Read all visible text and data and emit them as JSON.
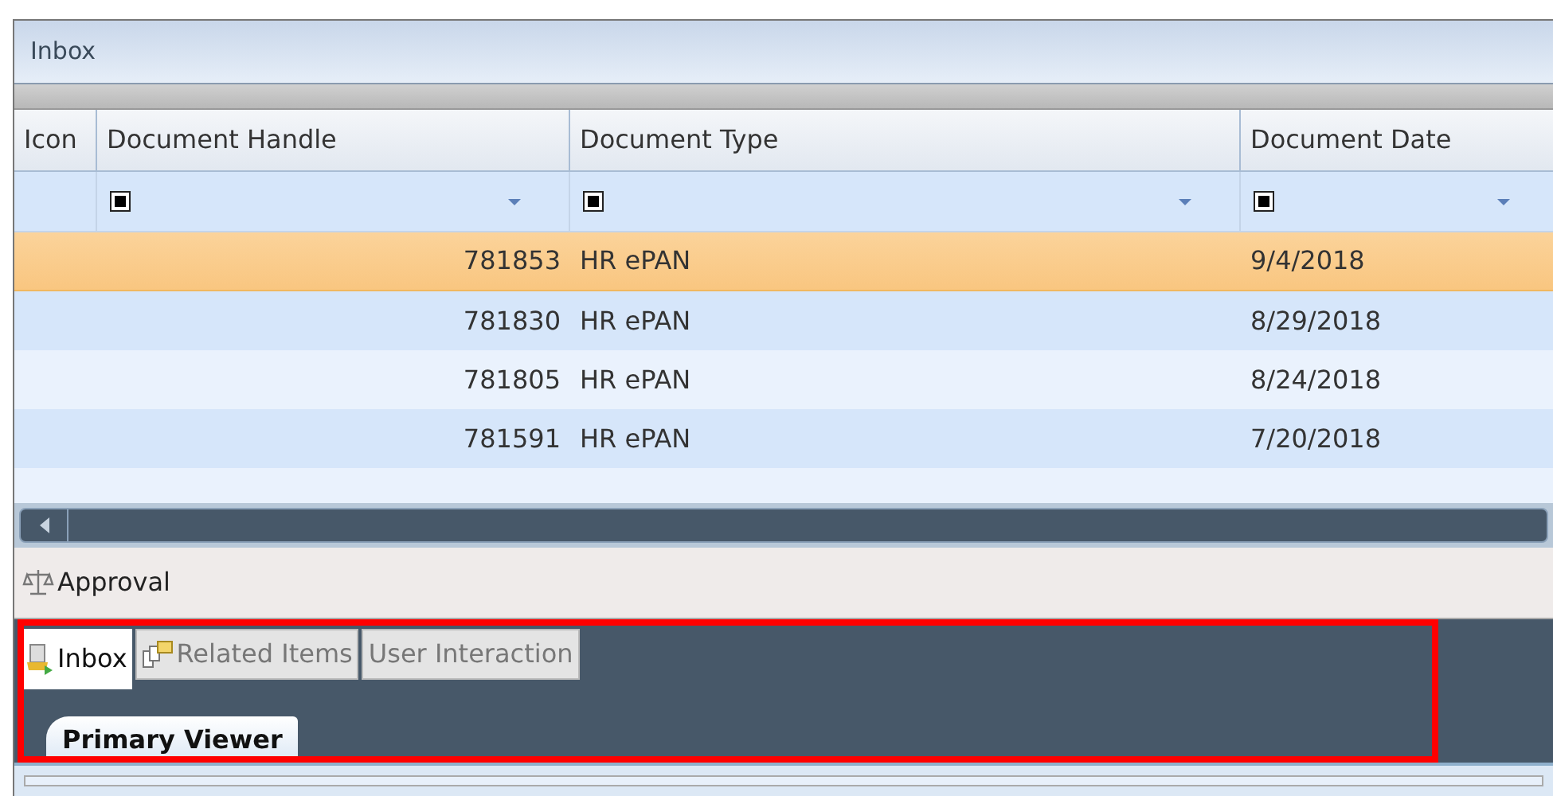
{
  "window": {
    "title": "Inbox"
  },
  "table": {
    "columns": [
      {
        "label": "Icon",
        "filter": false
      },
      {
        "label": "Document Handle",
        "filter": true
      },
      {
        "label": "Document Type",
        "filter": true
      },
      {
        "label": "Document Date",
        "filter": true
      }
    ],
    "rows": [
      {
        "handle": "781853",
        "type": "HR ePAN",
        "date": "9/4/2018",
        "selected": true
      },
      {
        "handle": "781830",
        "type": "HR ePAN",
        "date": "8/29/2018",
        "selected": false
      },
      {
        "handle": "781805",
        "type": "HR ePAN",
        "date": "8/24/2018",
        "selected": false
      },
      {
        "handle": "781591",
        "type": "HR ePAN",
        "date": "7/20/2018",
        "selected": false
      }
    ]
  },
  "section": {
    "label": "Approval"
  },
  "tabs": [
    {
      "label": "Inbox",
      "selected": true
    },
    {
      "label": "Related Items",
      "selected": false
    },
    {
      "label": "User Interaction",
      "selected": false
    }
  ],
  "viewer_tabs": [
    {
      "label": "Primary Viewer",
      "selected": true
    }
  ],
  "highlight": {
    "on": true
  }
}
